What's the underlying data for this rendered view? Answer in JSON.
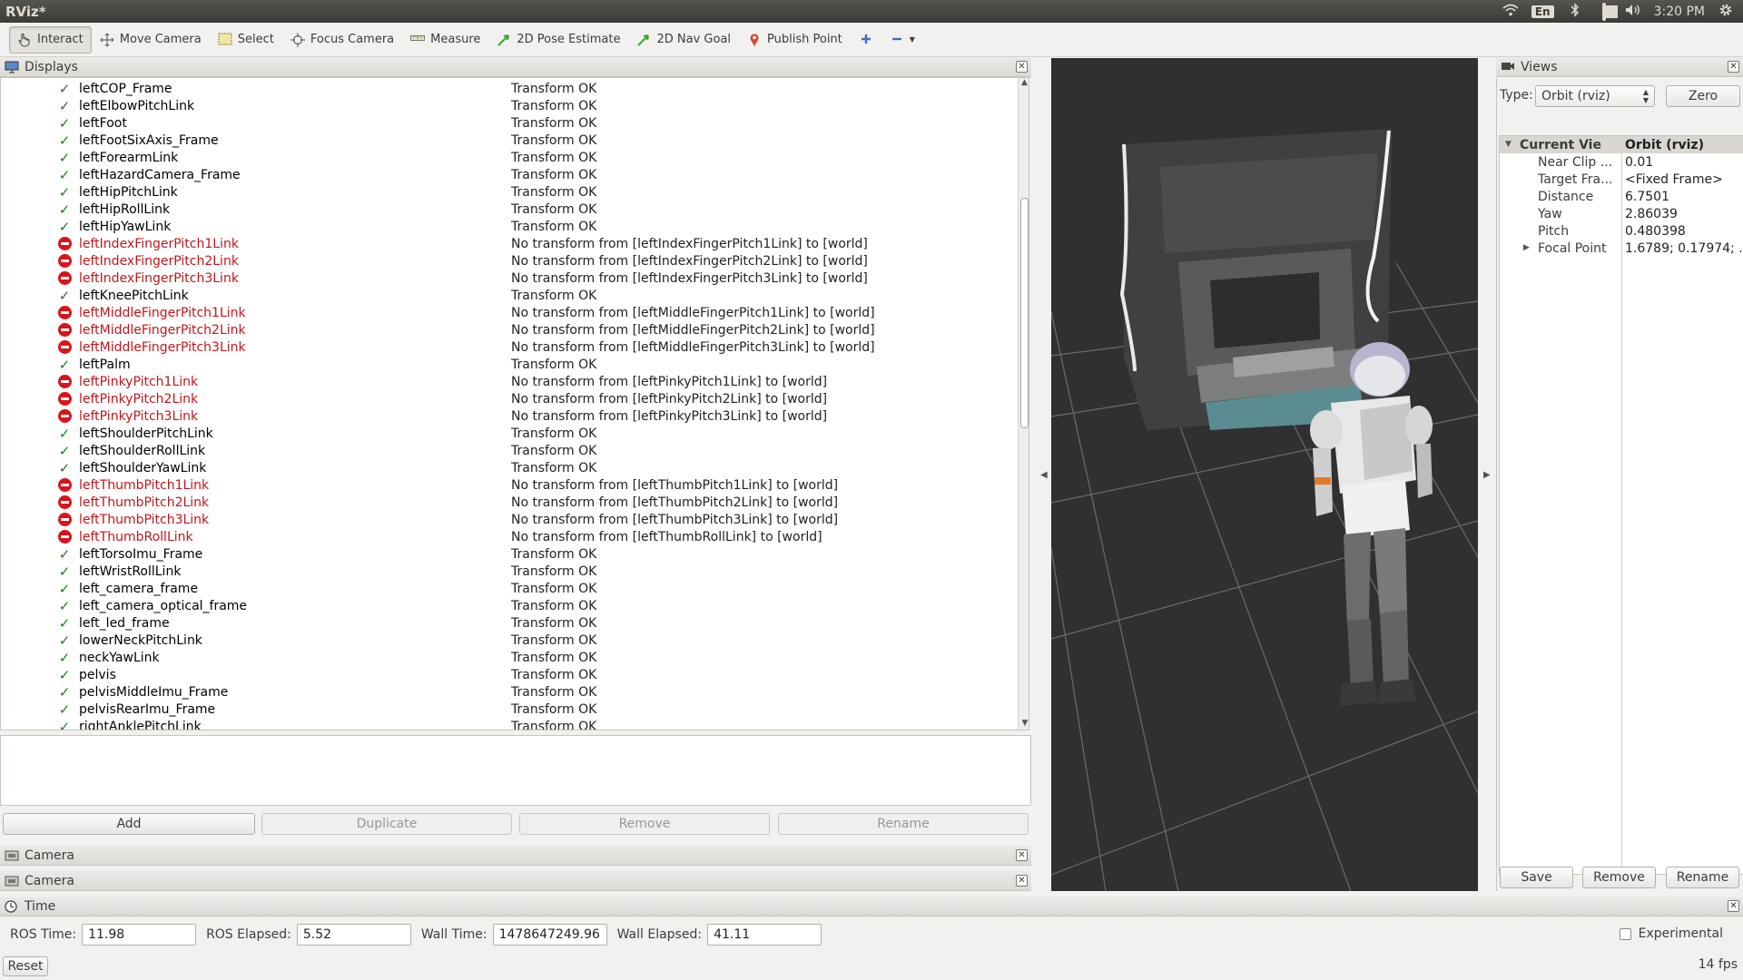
{
  "window": {
    "title": "RViz*"
  },
  "tray": {
    "keyboard": "En",
    "clock": "3:20 PM",
    "battery_level": 0.8
  },
  "toolbar": {
    "tools": [
      {
        "label": "Interact",
        "icon": "hand-cursor-icon",
        "active": true
      },
      {
        "label": "Move Camera",
        "icon": "move-camera-icon"
      },
      {
        "label": "Select",
        "icon": "select-box-icon"
      },
      {
        "label": "Focus Camera",
        "icon": "focus-camera-icon"
      },
      {
        "label": "Measure",
        "icon": "ruler-icon"
      },
      {
        "label": "2D Pose Estimate",
        "icon": "green-arrow-icon"
      },
      {
        "label": "2D Nav Goal",
        "icon": "green-arrow-icon"
      },
      {
        "label": "Publish Point",
        "icon": "map-pin-icon"
      }
    ]
  },
  "displays": {
    "title": "Displays",
    "rows": [
      {
        "name": "leftCOP_Frame",
        "status": "ok",
        "message": "Transform OK"
      },
      {
        "name": "leftElbowPitchLink",
        "status": "ok",
        "message": "Transform OK"
      },
      {
        "name": "leftFoot",
        "status": "ok",
        "message": "Transform OK"
      },
      {
        "name": "leftFootSixAxis_Frame",
        "status": "ok",
        "message": "Transform OK"
      },
      {
        "name": "leftForearmLink",
        "status": "ok",
        "message": "Transform OK"
      },
      {
        "name": "leftHazardCamera_Frame",
        "status": "ok",
        "message": "Transform OK"
      },
      {
        "name": "leftHipPitchLink",
        "status": "ok",
        "message": "Transform OK"
      },
      {
        "name": "leftHipRollLink",
        "status": "ok",
        "message": "Transform OK"
      },
      {
        "name": "leftHipYawLink",
        "status": "ok",
        "message": "Transform OK"
      },
      {
        "name": "leftIndexFingerPitch1Link",
        "status": "error",
        "message": "No transform from [leftIndexFingerPitch1Link] to [world]"
      },
      {
        "name": "leftIndexFingerPitch2Link",
        "status": "error",
        "message": "No transform from [leftIndexFingerPitch2Link] to [world]"
      },
      {
        "name": "leftIndexFingerPitch3Link",
        "status": "error",
        "message": "No transform from [leftIndexFingerPitch3Link] to [world]"
      },
      {
        "name": "leftKneePitchLink",
        "status": "ok",
        "message": "Transform OK"
      },
      {
        "name": "leftMiddleFingerPitch1Link",
        "status": "error",
        "message": "No transform from [leftMiddleFingerPitch1Link] to [world]"
      },
      {
        "name": "leftMiddleFingerPitch2Link",
        "status": "error",
        "message": "No transform from [leftMiddleFingerPitch2Link] to [world]"
      },
      {
        "name": "leftMiddleFingerPitch3Link",
        "status": "error",
        "message": "No transform from [leftMiddleFingerPitch3Link] to [world]"
      },
      {
        "name": "leftPalm",
        "status": "ok",
        "message": "Transform OK"
      },
      {
        "name": "leftPinkyPitch1Link",
        "status": "error",
        "message": "No transform from [leftPinkyPitch1Link] to [world]"
      },
      {
        "name": "leftPinkyPitch2Link",
        "status": "error",
        "message": "No transform from [leftPinkyPitch2Link] to [world]"
      },
      {
        "name": "leftPinkyPitch3Link",
        "status": "error",
        "message": "No transform from [leftPinkyPitch3Link] to [world]"
      },
      {
        "name": "leftShoulderPitchLink",
        "status": "ok",
        "message": "Transform OK"
      },
      {
        "name": "leftShoulderRollLink",
        "status": "ok",
        "message": "Transform OK"
      },
      {
        "name": "leftShoulderYawLink",
        "status": "ok",
        "message": "Transform OK"
      },
      {
        "name": "leftThumbPitch1Link",
        "status": "error",
        "message": "No transform from [leftThumbPitch1Link] to [world]"
      },
      {
        "name": "leftThumbPitch2Link",
        "status": "error",
        "message": "No transform from [leftThumbPitch2Link] to [world]"
      },
      {
        "name": "leftThumbPitch3Link",
        "status": "error",
        "message": "No transform from [leftThumbPitch3Link] to [world]"
      },
      {
        "name": "leftThumbRollLink",
        "status": "error",
        "message": "No transform from [leftThumbRollLink] to [world]"
      },
      {
        "name": "leftTorsoImu_Frame",
        "status": "ok",
        "message": "Transform OK"
      },
      {
        "name": "leftWristRollLink",
        "status": "ok",
        "message": "Transform OK"
      },
      {
        "name": "left_camera_frame",
        "status": "ok",
        "message": "Transform OK"
      },
      {
        "name": "left_camera_optical_frame",
        "status": "ok",
        "message": "Transform OK"
      },
      {
        "name": "left_led_frame",
        "status": "ok",
        "message": "Transform OK"
      },
      {
        "name": "lowerNeckPitchLink",
        "status": "ok",
        "message": "Transform OK"
      },
      {
        "name": "neckYawLink",
        "status": "ok",
        "message": "Transform OK"
      },
      {
        "name": "pelvis",
        "status": "ok",
        "message": "Transform OK"
      },
      {
        "name": "pelvisMiddleImu_Frame",
        "status": "ok",
        "message": "Transform OK"
      },
      {
        "name": "pelvisRearImu_Frame",
        "status": "ok",
        "message": "Transform OK"
      },
      {
        "name": "rightAnklePitchLink",
        "status": "ok",
        "message": "Transform OK"
      }
    ],
    "buttons": {
      "add": "Add",
      "duplicate": "Duplicate",
      "remove": "Remove",
      "rename": "Rename"
    }
  },
  "camera_panels": [
    "Camera",
    "Camera"
  ],
  "views": {
    "title": "Views",
    "type_label": "Type:",
    "type_value": "Orbit (rviz)",
    "zero": "Zero",
    "current_view": {
      "label": "Current View",
      "value": "Orbit (rviz)"
    },
    "properties": [
      {
        "key": "Near Clip ...",
        "value": "0.01"
      },
      {
        "key": "Target Fra...",
        "value": "<Fixed Frame>"
      },
      {
        "key": "Distance",
        "value": "6.7501"
      },
      {
        "key": "Yaw",
        "value": "2.86039"
      },
      {
        "key": "Pitch",
        "value": "0.480398"
      },
      {
        "key": "Focal Point",
        "value": "1.6789; 0.17974; ..."
      }
    ],
    "buttons": {
      "save": "Save",
      "remove": "Remove",
      "rename": "Rename"
    }
  },
  "time": {
    "title": "Time",
    "ros_time_label": "ROS Time:",
    "ros_time": "11.98",
    "ros_elapsed_label": "ROS Elapsed:",
    "ros_elapsed": "5.52",
    "wall_time_label": "Wall Time:",
    "wall_time": "1478647249.96",
    "wall_elapsed_label": "Wall Elapsed:",
    "wall_elapsed": "41.11",
    "experimental": "Experimental"
  },
  "status": {
    "reset": "Reset",
    "fps": "14 fps"
  },
  "colors": {
    "error": "#c0161a",
    "ok_check": "#1f7a1f",
    "viewport_bg": "#303030"
  }
}
